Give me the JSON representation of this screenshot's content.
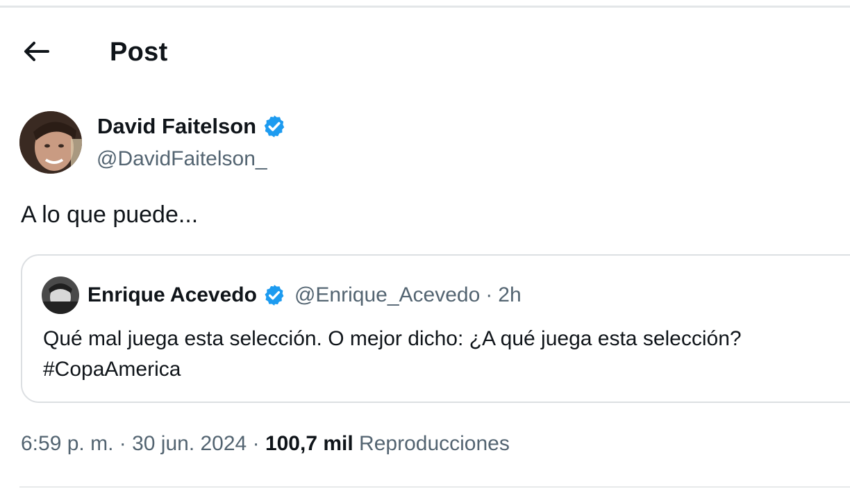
{
  "header": {
    "title": "Post"
  },
  "author": {
    "name": "David Faitelson",
    "handle": "@DavidFaitelson_"
  },
  "post": {
    "text": "A lo que puede..."
  },
  "quote": {
    "name": "Enrique Acevedo",
    "handle": "@Enrique_Acevedo",
    "separator": "·",
    "time": "2h",
    "line1": "Qué mal juega esta selección. O mejor dicho: ¿A qué juega esta selección?",
    "line2": "#CopaAmerica"
  },
  "meta": {
    "time": "6:59 p. m.",
    "sep1": "·",
    "date": "30 jun. 2024",
    "sep2": "·",
    "views_count": "100,7 mil",
    "views_label": "Reproducciones"
  },
  "icons": {
    "back": "arrow-left-icon",
    "verified": "verified-badge-icon"
  },
  "colors": {
    "verified": "#1d9bf0",
    "secondary_text": "#536471",
    "primary_text": "#0f1419",
    "border": "#dcdfe2"
  }
}
